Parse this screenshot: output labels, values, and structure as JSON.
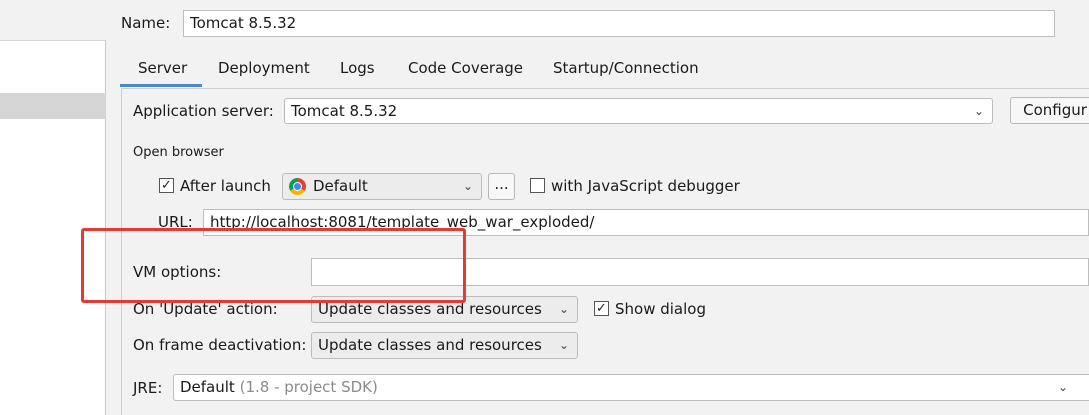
{
  "name": {
    "label": "Name:",
    "value": "Tomcat 8.5.32"
  },
  "tabs": [
    {
      "label": "Server",
      "active": true
    },
    {
      "label": "Deployment"
    },
    {
      "label": "Logs"
    },
    {
      "label": "Code Coverage"
    },
    {
      "label": "Startup/Connection"
    }
  ],
  "app_server": {
    "label": "Application server:",
    "value": "Tomcat 8.5.32",
    "configure_label": "Configur"
  },
  "open_browser": {
    "section_label": "Open browser",
    "after_launch_label": "After launch",
    "after_launch_checked": true,
    "browser_value": "Default",
    "browser_icon": "chrome-icon",
    "ellipsis_label": "...",
    "js_debugger_label": "with JavaScript debugger",
    "js_debugger_checked": false,
    "url_label": "URL:",
    "url_value": "http://localhost:8081/template_web_war_exploded/"
  },
  "vm_options": {
    "label": "VM options:",
    "value": ""
  },
  "on_update": {
    "label": "On 'Update' action:",
    "value": "Update classes and resources",
    "show_dialog_label": "Show dialog",
    "show_dialog_checked": true
  },
  "on_frame_deactivation": {
    "label": "On frame deactivation:",
    "value": "Update classes and resources"
  },
  "jre": {
    "label": "JRE:",
    "value": "Default",
    "hint": "(1.8 - project SDK)"
  },
  "colors": {
    "active_tab_underline": "#4a88c7",
    "highlight": "#e53935",
    "background": "#f2f2f2"
  }
}
